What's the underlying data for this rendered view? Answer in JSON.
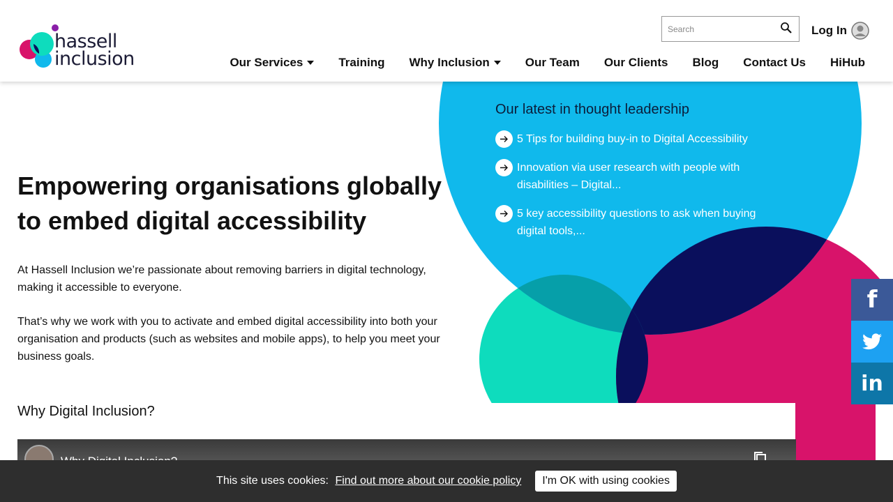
{
  "brand": {
    "name_line1": "hassell",
    "name_line2": "inclusion"
  },
  "header": {
    "search_placeholder": "Search",
    "login_label": "Log In"
  },
  "nav": {
    "items": [
      {
        "label": "Our Services",
        "dropdown": true
      },
      {
        "label": "Training",
        "dropdown": false
      },
      {
        "label": "Why Inclusion",
        "dropdown": true
      },
      {
        "label": "Our Team",
        "dropdown": false
      },
      {
        "label": "Our Clients",
        "dropdown": false
      },
      {
        "label": "Blog",
        "dropdown": false
      },
      {
        "label": "Contact Us",
        "dropdown": false
      },
      {
        "label": "HiHub",
        "dropdown": false
      }
    ]
  },
  "hero": {
    "title": "Empowering organisations globally to embed digital accessibility",
    "paragraph1": "At Hassell Inclusion we’re passionate about removing barriers in digital technology, making it accessible to everyone.",
    "paragraph2": "That’s why we work with you to activate and embed digital accessibility into both your organisation and products (such as websites and mobile apps), to help you meet your business goals."
  },
  "thought_leadership": {
    "title": "Our latest in thought leadership",
    "items": [
      {
        "label": "5 Tips for building buy-in to Digital Accessibility"
      },
      {
        "label": "Innovation via user research with people with disabilities – Digital..."
      },
      {
        "label": "5 key accessibility questions to ask when buying digital tools,..."
      }
    ]
  },
  "why_section": {
    "title": "Why Digital Inclusion?",
    "video_title": "Why Digital Inclusion?"
  },
  "social": {
    "facebook": "f",
    "twitter": "twitter-bird-icon",
    "linkedin": "in"
  },
  "cookie": {
    "text": "This site uses cookies:",
    "link": "Find out more about our cookie policy",
    "button": "I'm OK with using cookies"
  },
  "colors": {
    "sky_blue": "#10b9ec",
    "navy": "#0a0f5c",
    "magenta": "#d8136a",
    "teal": "#0edcbd",
    "purple_dot": "#8a1fa8",
    "cookie_bg": "#2e2e2e"
  }
}
